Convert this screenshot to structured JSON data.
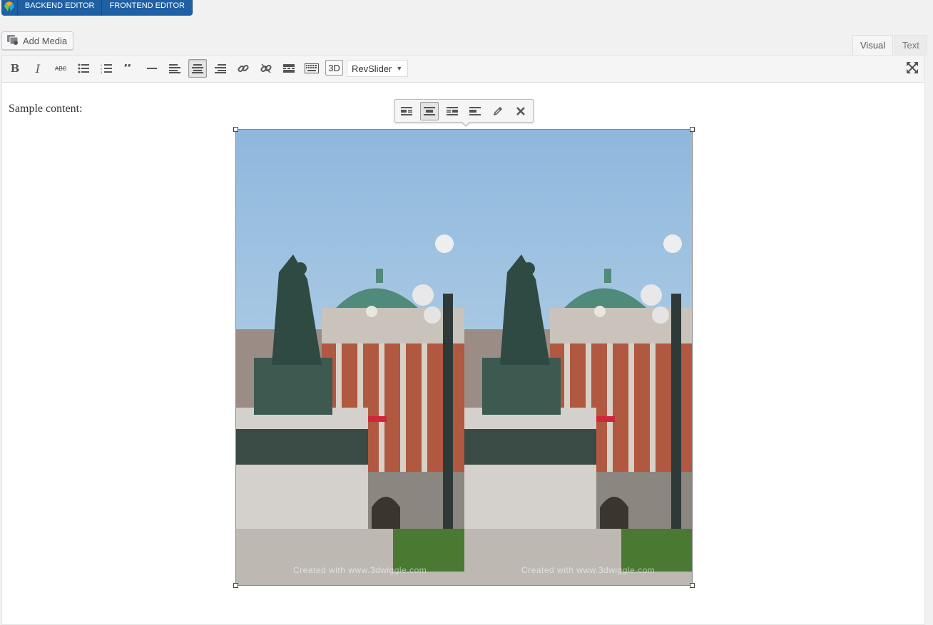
{
  "builder_bar": {
    "backend_label": "BACKEND EDITOR",
    "frontend_label": "FRONTEND EDITOR"
  },
  "media": {
    "add_label": "Add Media"
  },
  "tabs": {
    "visual": "Visual",
    "text": "Text"
  },
  "toolbar": {
    "bold": "B",
    "italic": "I",
    "three_d": "3D",
    "revslider": "RevSlider"
  },
  "content": {
    "paragraph": "Sample content:",
    "watermark": "Created with www.3dwiggle.com"
  },
  "colors": {
    "builder_bar": "#1f5fa3",
    "sky": "#a9cbe8",
    "dome": "#4f8a7a"
  }
}
